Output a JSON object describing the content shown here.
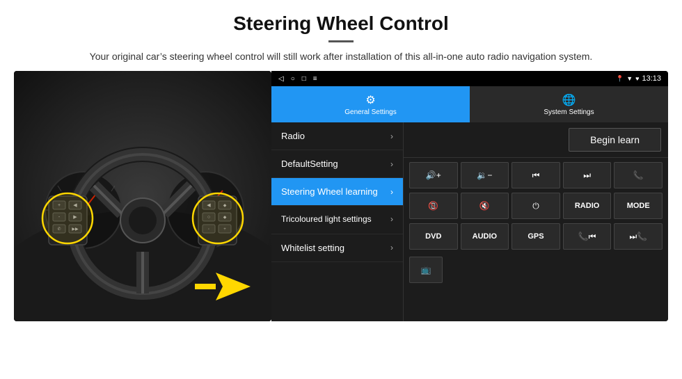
{
  "header": {
    "title": "Steering Wheel Control",
    "subtitle": "Your original car’s steering wheel control will still work after installation of this all-in-one auto radio navigation system."
  },
  "status_bar": {
    "nav_icons": [
      "◁",
      "○",
      "□"
    ],
    "notification_icon": "≡",
    "location_icon": "☀",
    "wifi_icon": "▼",
    "signal_icon": "♥",
    "time": "13:13"
  },
  "tabs": [
    {
      "label": "General Settings",
      "icon": "⚙",
      "active": true
    },
    {
      "label": "System Settings",
      "icon": "🌐",
      "active": false
    }
  ],
  "menu_items": [
    {
      "label": "Radio",
      "active": false
    },
    {
      "label": "DefaultSetting",
      "active": false
    },
    {
      "label": "Steering Wheel learning",
      "active": true
    },
    {
      "label": "Tricoloured light settings",
      "active": false
    },
    {
      "label": "Whitelist setting",
      "active": false
    }
  ],
  "controls": {
    "begin_learn_label": "Begin learn",
    "buttons_row1": [
      {
        "icon": "🔊+",
        "label": "vol-up"
      },
      {
        "icon": "🔉−",
        "label": "vol-down"
      },
      {
        "icon": "⏮",
        "label": "prev"
      },
      {
        "icon": "⏭",
        "label": "next"
      },
      {
        "icon": "📞",
        "label": "phone"
      }
    ],
    "buttons_row2": [
      {
        "icon": "✆",
        "label": "hangup"
      },
      {
        "icon": "🔇",
        "label": "mute"
      },
      {
        "icon": "⏻",
        "label": "power"
      },
      {
        "text": "RADIO",
        "label": "radio-btn"
      },
      {
        "text": "MODE",
        "label": "mode-btn"
      }
    ],
    "buttons_row3": [
      {
        "text": "DVD",
        "label": "dvd-btn"
      },
      {
        "text": "AUDIO",
        "label": "audio-btn"
      },
      {
        "text": "GPS",
        "label": "gps-btn"
      },
      {
        "icon": "📞⏮",
        "label": "tel-prev"
      },
      {
        "icon": "⏮📞",
        "label": "tel-next"
      }
    ]
  },
  "colors": {
    "active_blue": "#2196f3",
    "dark_bg": "#1c1c1c",
    "button_bg": "#2a2a2a",
    "yellow_highlight": "#FFD700"
  }
}
